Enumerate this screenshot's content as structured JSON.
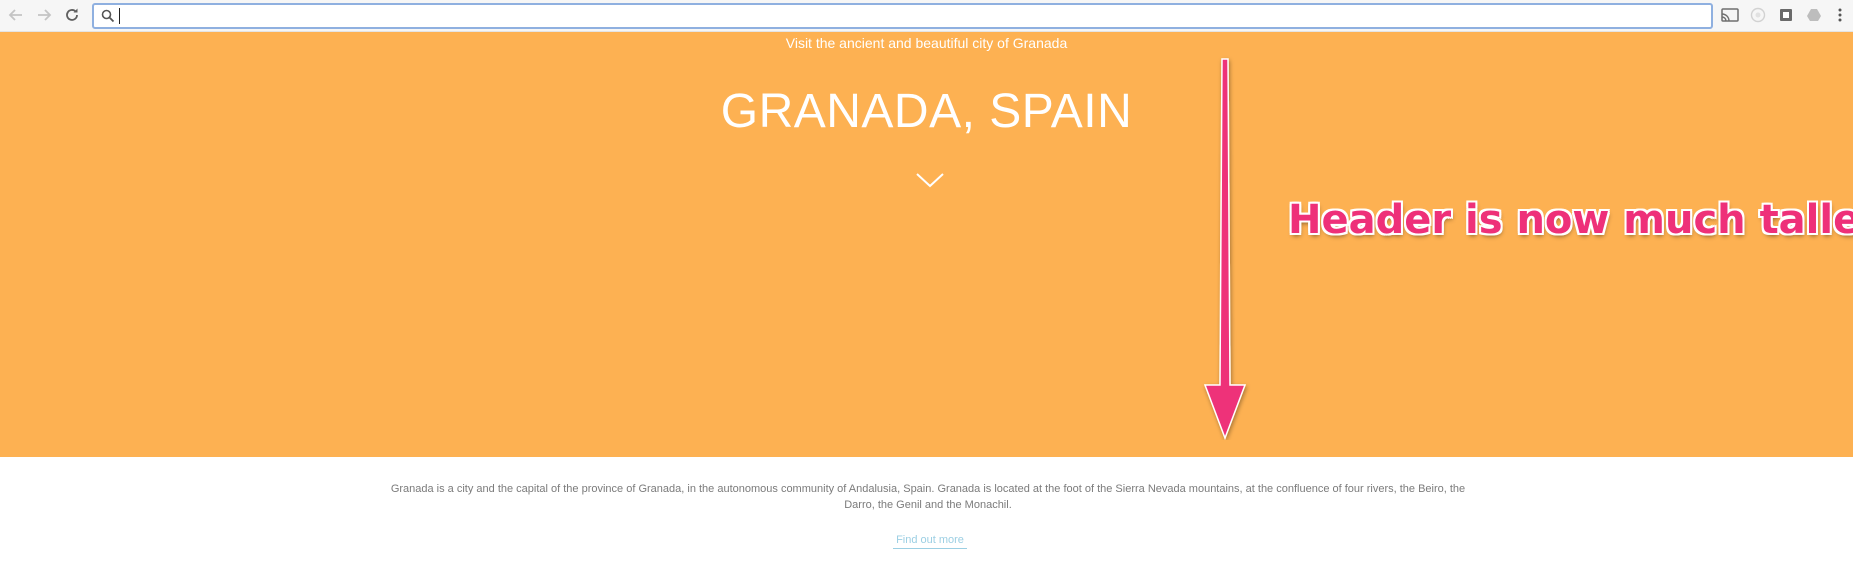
{
  "browser": {
    "back_icon": "arrow-left-icon",
    "forward_icon": "arrow-right-icon",
    "reload_icon": "reload-icon",
    "search_icon": "magnifier-icon",
    "address_value": "",
    "extensions": [
      "cast-icon",
      "extension-icon",
      "extension-icon",
      "drive-icon",
      "more-vertical-icon"
    ]
  },
  "page": {
    "tagline": "Visit the ancient and beautiful city of Granada",
    "title": "GRANADA, SPAIN",
    "chevron_icon": "chevron-down-icon",
    "intro": "Granada is a city and the capital of the province of Granada, in the autonomous community of Andalusia, Spain. Granada is located at the foot of the Sierra Nevada mountains, at the confluence of four rivers, the Beiro, the Darro, the Genil and the Monachil.",
    "find_more": "Find out more"
  },
  "annotation": {
    "text": "Header is now much taller",
    "arrow_icon": "arrow-down-icon"
  },
  "colors": {
    "hero_background": "#fdb152",
    "annotation": "#ee3079",
    "link": "#9ccfe3"
  }
}
